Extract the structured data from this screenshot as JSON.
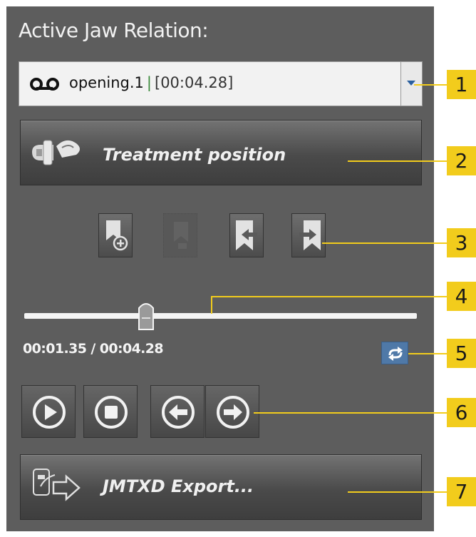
{
  "panel": {
    "title": "Active Jaw Relation:",
    "dropdown": {
      "recording_name": "opening.1",
      "separator": "|",
      "duration": "[00:04.28]",
      "icon": "recording-icon",
      "arrow_icon": "dropdown-arrow-icon"
    },
    "treatment_button": {
      "label": "Treatment position",
      "icon": "jaw-treatment-icon"
    },
    "bookmark_tools": [
      {
        "name": "add-bookmark",
        "icon": "bookmark-add-icon",
        "enabled": true
      },
      {
        "name": "remove-bookmark",
        "icon": "bookmark-remove-icon",
        "enabled": false
      },
      {
        "name": "previous-bookmark",
        "icon": "bookmark-prev-icon",
        "enabled": true
      },
      {
        "name": "next-bookmark",
        "icon": "bookmark-next-icon",
        "enabled": true
      }
    ],
    "timeline": {
      "position_fraction": 0.31
    },
    "time_readout": "00:01.35 / 00:04.28",
    "loop_button": {
      "icon": "loop-icon",
      "active": true
    },
    "playback": [
      {
        "name": "play",
        "icon": "play-icon"
      },
      {
        "name": "stop",
        "icon": "stop-icon"
      },
      {
        "name": "step-back",
        "icon": "arrow-left-icon"
      },
      {
        "name": "step-forward",
        "icon": "arrow-right-icon"
      }
    ],
    "export_button": {
      "label": "JMTXD Export...",
      "icon": "export-icon"
    }
  },
  "callouts": [
    "1",
    "2",
    "3",
    "4",
    "5",
    "6",
    "7"
  ],
  "colors": {
    "panel_bg": "#5d5d5d",
    "callout": "#f2cc1c",
    "loop_active": "#4f79a8"
  }
}
